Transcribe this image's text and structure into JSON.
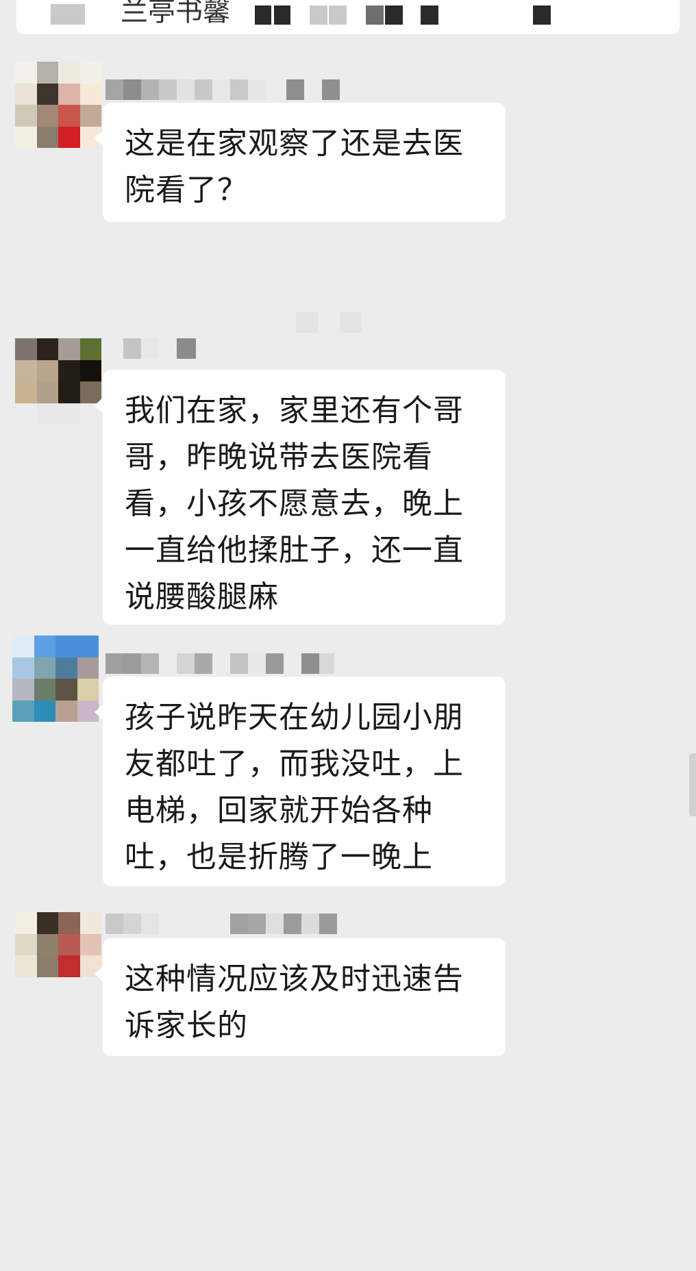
{
  "quoted_message": {
    "text": "兰亭书馨"
  },
  "messages": [
    {
      "text": "这是在家观察了还是去医院看了？"
    },
    {
      "text": "我们在家，家里还有个哥哥，昨晚说带去医院看看，小孩不愿意去，晚上一直给他揉肚子，还一直说腰酸腿麻"
    },
    {
      "text": "孩子说昨天在幼儿园小朋友都吐了，而我没吐，上电梯，回家就开始各种吐，也是折腾了一晚上"
    },
    {
      "text": "这种情况应该及时迅速告诉家长的"
    }
  ],
  "colors": {
    "background": "#ececec",
    "bubble": "#ffffff",
    "text": "#191919"
  }
}
